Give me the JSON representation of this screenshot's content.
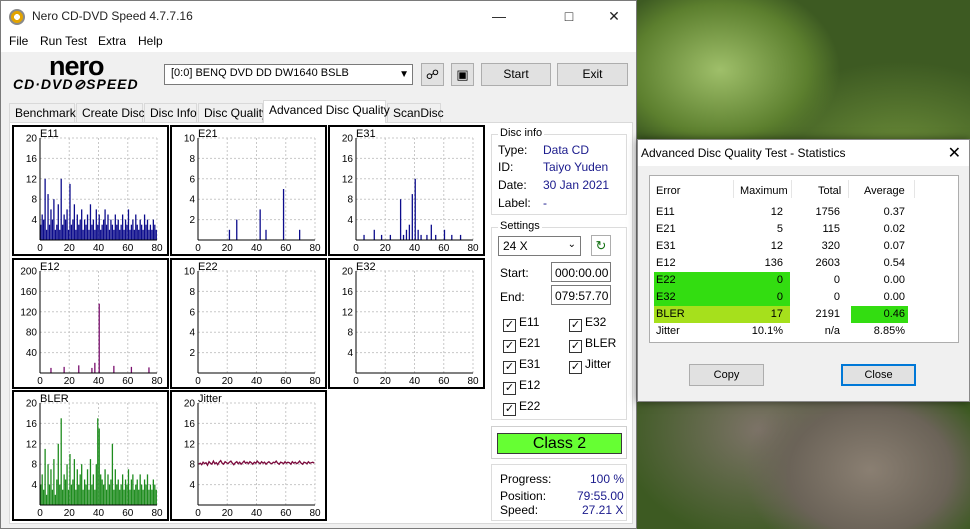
{
  "window": {
    "title": "Nero CD-DVD Speed 4.7.7.16",
    "menu": [
      "File",
      "Run Test",
      "Extra",
      "Help"
    ],
    "logo_top": "nero",
    "logo_bottom": "CD·DVD⊘SPEED",
    "drive": "[0:0]  BENQ DVD DD DW1640 BSLB",
    "start_label": "Start",
    "exit_label": "Exit"
  },
  "tabs": [
    "Benchmark",
    "Create Disc",
    "Disc Info",
    "Disc Quality",
    "Advanced Disc Quality",
    "ScanDisc"
  ],
  "active_tab": "Advanced Disc Quality",
  "disc_info": {
    "title": "Disc info",
    "type_label": "Type:",
    "type": "Data CD",
    "id_label": "ID:",
    "id": "Taiyo Yuden",
    "date_label": "Date:",
    "date": "30 Jan 2021",
    "label_label": "Label:",
    "label": "-"
  },
  "settings": {
    "title": "Settings",
    "speed": "24 X",
    "start_label": "Start:",
    "start": "000:00.00",
    "end_label": "End:",
    "end": "079:57.70",
    "checks": [
      {
        "label": "E11",
        "checked": true
      },
      {
        "label": "E32",
        "checked": true
      },
      {
        "label": "E21",
        "checked": true
      },
      {
        "label": "BLER",
        "checked": true
      },
      {
        "label": "E31",
        "checked": true
      },
      {
        "label": "Jitter",
        "checked": true
      },
      {
        "label": "E12",
        "checked": true
      },
      {
        "label": "E22",
        "checked": true
      }
    ]
  },
  "class_label": "Class 2",
  "progress": {
    "progress_label": "Progress:",
    "progress": "100 %",
    "position_label": "Position:",
    "position": "79:55.00",
    "speed_label": "Speed:",
    "speed": "27.21 X"
  },
  "colors": {
    "navy": "#0c0c8c",
    "purple": "#7a0f6e",
    "green": "#1e8c1e",
    "maroon": "#7a0a3c",
    "highlight": "#33dd11",
    "class_green": "#66ff33"
  },
  "chart_data": [
    {
      "type": "bar",
      "title": "E11",
      "x_ticks": [
        0,
        20,
        40,
        60,
        80
      ],
      "y_ticks": [
        20,
        16,
        12,
        8,
        4
      ],
      "ylim": [
        0,
        20
      ],
      "xlim": [
        0,
        80
      ],
      "color": "#0c0c8c",
      "values": [
        3,
        5,
        4,
        12,
        2,
        9,
        3,
        6,
        4,
        8,
        2,
        3,
        7,
        2,
        12,
        3,
        5,
        4,
        6,
        2,
        11,
        3,
        4,
        7,
        2,
        5,
        3,
        4,
        6,
        2,
        4,
        3,
        5,
        2,
        7,
        3,
        4,
        2,
        6,
        3,
        5,
        2,
        3,
        4,
        6,
        3,
        5,
        2,
        4,
        3,
        2,
        5,
        3,
        4,
        2,
        3,
        5,
        2,
        4,
        3,
        6,
        2,
        3,
        4,
        2,
        5,
        3,
        2,
        4,
        3,
        2,
        5,
        3,
        4,
        2,
        3,
        2,
        4,
        3,
        2
      ]
    },
    {
      "type": "bar",
      "title": "E21",
      "x_ticks": [
        0,
        20,
        40,
        60,
        80
      ],
      "y_ticks": [
        10,
        8,
        6,
        4,
        2
      ],
      "ylim": [
        0,
        10
      ],
      "xlim": [
        0,
        80
      ],
      "color": "#0c0c8c",
      "values": [
        0,
        0,
        0,
        0,
        0,
        0,
        0,
        0,
        0,
        0,
        0,
        0,
        0,
        0,
        0,
        0,
        0,
        0,
        0,
        0,
        0,
        1,
        0,
        0,
        0,
        0,
        2,
        0,
        0,
        0,
        0,
        0,
        0,
        0,
        0,
        0,
        0,
        0,
        0,
        0,
        0,
        0,
        3,
        0,
        0,
        0,
        1,
        0,
        0,
        0,
        0,
        0,
        0,
        0,
        0,
        0,
        0,
        0,
        5,
        0,
        0,
        0,
        0,
        0,
        0,
        0,
        0,
        0,
        0,
        1,
        0,
        0,
        0,
        0,
        0,
        0,
        0,
        0,
        0,
        0
      ]
    },
    {
      "type": "bar",
      "title": "E31",
      "x_ticks": [
        0,
        20,
        40,
        60,
        80
      ],
      "y_ticks": [
        20,
        16,
        12,
        8,
        4
      ],
      "ylim": [
        0,
        20
      ],
      "xlim": [
        0,
        80
      ],
      "color": "#0c0c8c",
      "values": [
        0,
        0,
        0,
        0,
        0,
        1,
        0,
        0,
        0,
        0,
        0,
        0,
        2,
        0,
        0,
        0,
        0,
        1,
        0,
        0,
        0,
        0,
        0,
        1,
        0,
        0,
        0,
        0,
        0,
        0,
        8,
        0,
        1,
        0,
        2,
        0,
        3,
        0,
        9,
        0,
        12,
        0,
        2,
        0,
        1,
        0,
        0,
        0,
        1,
        0,
        0,
        3,
        0,
        0,
        1,
        0,
        0,
        0,
        0,
        0,
        2,
        0,
        0,
        0,
        0,
        1,
        0,
        0,
        0,
        0,
        0,
        1,
        0,
        0,
        0,
        0,
        0,
        0,
        0,
        0
      ]
    },
    {
      "type": "bar",
      "title": "E12",
      "x_ticks": [
        0,
        20,
        40,
        60,
        80
      ],
      "y_ticks": [
        200,
        160,
        120,
        80,
        40
      ],
      "ylim": [
        0,
        200
      ],
      "xlim": [
        0,
        80
      ],
      "color": "#7a0f6e",
      "values": [
        0,
        0,
        0,
        0,
        0,
        0,
        0,
        10,
        0,
        0,
        0,
        0,
        0,
        0,
        0,
        0,
        12,
        0,
        0,
        0,
        0,
        0,
        0,
        0,
        0,
        0,
        15,
        0,
        0,
        0,
        0,
        0,
        0,
        0,
        0,
        10,
        0,
        20,
        0,
        0,
        136,
        0,
        0,
        0,
        0,
        0,
        0,
        0,
        0,
        0,
        14,
        0,
        0,
        0,
        0,
        0,
        0,
        0,
        0,
        0,
        0,
        0,
        12,
        0,
        0,
        0,
        0,
        0,
        0,
        0,
        0,
        0,
        0,
        0,
        11,
        0,
        0,
        0,
        0,
        0
      ]
    },
    {
      "type": "bar",
      "title": "E22",
      "x_ticks": [
        0,
        20,
        40,
        60,
        80
      ],
      "y_ticks": [
        10,
        8,
        6,
        4,
        2
      ],
      "ylim": [
        0,
        10
      ],
      "xlim": [
        0,
        80
      ],
      "color": "#7a0f6e",
      "values": []
    },
    {
      "type": "bar",
      "title": "E32",
      "x_ticks": [
        0,
        20,
        40,
        60,
        80
      ],
      "y_ticks": [
        20,
        16,
        12,
        8,
        4
      ],
      "ylim": [
        0,
        20
      ],
      "xlim": [
        0,
        80
      ],
      "color": "#7a0f6e",
      "values": []
    },
    {
      "type": "bar",
      "title": "BLER",
      "x_ticks": [
        0,
        20,
        40,
        60,
        80
      ],
      "y_ticks": [
        20,
        16,
        12,
        8,
        4
      ],
      "ylim": [
        0,
        20
      ],
      "xlim": [
        0,
        80
      ],
      "color": "#1e8c1e",
      "values": [
        4,
        6,
        3,
        11,
        2,
        8,
        4,
        7,
        3,
        9,
        2,
        5,
        12,
        4,
        17,
        3,
        6,
        5,
        8,
        3,
        10,
        4,
        5,
        9,
        3,
        7,
        4,
        6,
        8,
        3,
        5,
        4,
        7,
        3,
        9,
        4,
        6,
        3,
        8,
        17,
        15,
        6,
        5,
        4,
        7,
        3,
        6,
        4,
        5,
        12,
        3,
        7,
        4,
        5,
        3,
        4,
        6,
        3,
        5,
        4,
        7,
        3,
        5,
        6,
        3,
        4,
        5,
        3,
        6,
        4,
        3,
        5,
        4,
        6,
        3,
        4,
        3,
        5,
        4,
        3
      ]
    },
    {
      "type": "line",
      "title": "Jitter",
      "x_ticks": [
        0,
        20,
        40,
        60,
        80
      ],
      "y_ticks": [
        20,
        16,
        12,
        8,
        4
      ],
      "ylim": [
        0,
        20
      ],
      "xlim": [
        0,
        80
      ],
      "color": "#7a0a3c",
      "values": [
        8.0,
        8.2,
        7.9,
        8.4,
        8.1,
        8.3,
        7.8,
        8.5,
        8.2,
        8.0,
        8.6,
        8.1,
        8.3,
        7.9,
        8.4,
        8.7,
        8.2,
        8.0,
        8.5,
        8.3,
        8.1,
        8.4,
        8.6,
        8.2,
        7.9,
        8.3,
        8.5,
        8.1,
        8.4,
        8.0,
        8.3,
        8.6,
        8.2,
        8.4,
        8.1,
        8.5,
        8.3,
        8.0,
        8.4,
        8.2,
        8.6,
        8.3,
        8.1,
        8.5,
        8.2,
        8.4,
        8.0,
        8.3,
        8.5,
        8.2,
        8.1,
        8.4,
        8.3,
        8.6,
        8.2,
        8.0,
        8.4,
        8.3,
        8.1,
        8.5,
        8.2,
        8.4,
        8.3,
        8.0,
        8.5,
        8.2,
        8.4,
        8.1,
        8.3,
        8.6,
        8.2,
        8.0,
        8.4,
        8.3,
        8.1,
        8.5,
        8.2,
        8.3,
        8.4,
        8.2
      ]
    }
  ],
  "stats_dialog": {
    "title": "Advanced Disc Quality Test - Statistics",
    "headers": [
      "Error",
      "Maximum",
      "Total",
      "Average"
    ],
    "rows": [
      {
        "error": "E11",
        "maximum": "12",
        "total": "1756",
        "average": "0.37"
      },
      {
        "error": "E21",
        "maximum": "5",
        "total": "115",
        "average": "0.02"
      },
      {
        "error": "E31",
        "maximum": "12",
        "total": "320",
        "average": "0.07"
      },
      {
        "error": "E12",
        "maximum": "136",
        "total": "2603",
        "average": "0.54"
      },
      {
        "error": "E22",
        "maximum": "0",
        "total": "0",
        "average": "0.00"
      },
      {
        "error": "E32",
        "maximum": "0",
        "total": "0",
        "average": "0.00"
      },
      {
        "error": "BLER",
        "maximum": "17",
        "total": "2191",
        "average": "0.46"
      },
      {
        "error": "Jitter",
        "maximum": "10.1%",
        "total": "n/a",
        "average": "8.85%"
      }
    ],
    "copy_label": "Copy",
    "close_label": "Close"
  }
}
